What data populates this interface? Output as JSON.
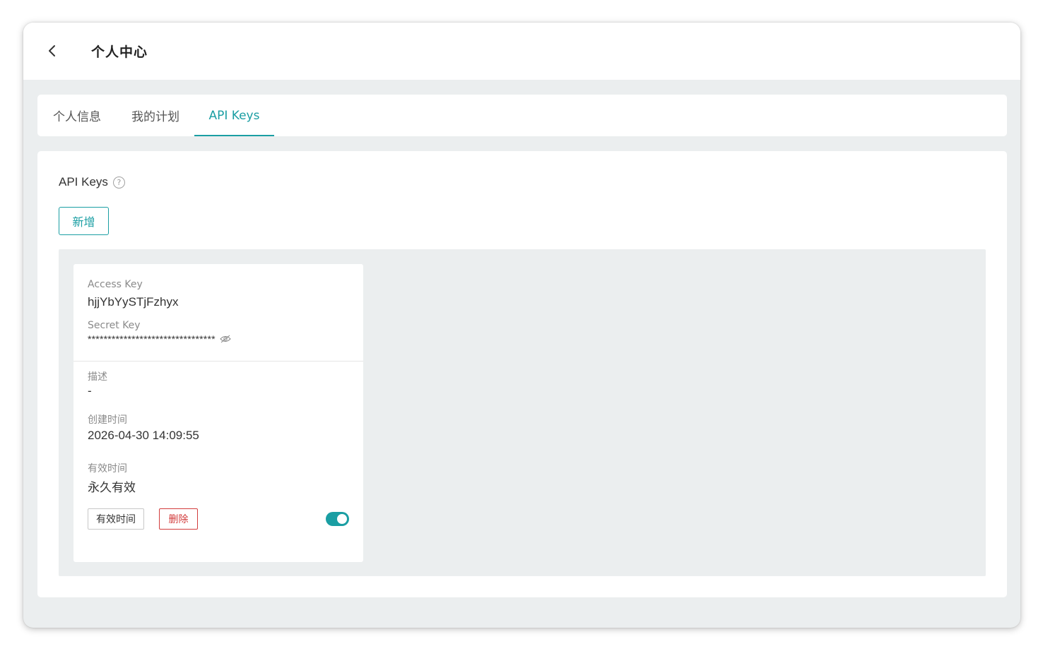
{
  "header": {
    "title": "个人中心",
    "back_icon": "chevron-left-icon"
  },
  "tabs": [
    {
      "label": "个人信息",
      "active": false
    },
    {
      "label": "我的计划",
      "active": false
    },
    {
      "label": "API Keys",
      "active": true
    }
  ],
  "section": {
    "title": "API Keys",
    "help_icon": "question-circle-icon",
    "add_label": "新增"
  },
  "key_card": {
    "access_key_label": "Access Key",
    "access_key_value": "hjjYbYySTjFzhyx",
    "secret_key_label": "Secret Key",
    "secret_key_value": "********************************",
    "eye_icon": "eye-slash-icon",
    "description_label": "描述",
    "description_value": "-",
    "created_label": "创建时间",
    "created_value": "2026-04-30 14:09:55",
    "validity_label": "有效时间",
    "validity_value": "永久有效",
    "expiry_button_label": "有效时间",
    "delete_button_label": "删除",
    "enabled": true
  },
  "colors": {
    "accent": "#1a9ea3",
    "danger": "#d23c3c",
    "background": "#ebeeef"
  }
}
